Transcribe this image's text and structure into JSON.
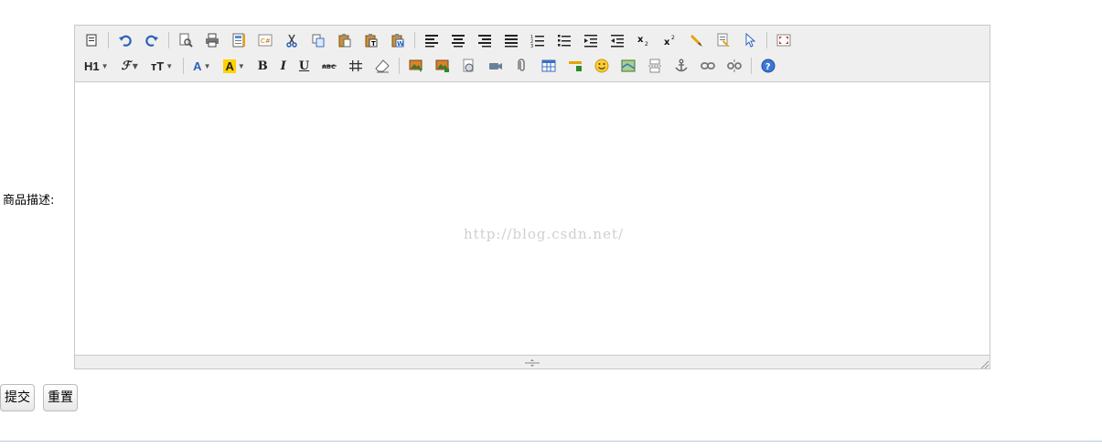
{
  "form": {
    "description_label": "商品描述:",
    "submit_label": "提交",
    "reset_label": "重置"
  },
  "editor": {
    "toolbar_row2_text": {
      "heading": "H1",
      "font_family": "ℱ",
      "font_size": "ᴛT"
    },
    "watermark": "http://blog.csdn.net/"
  },
  "colors": {
    "toolbar_bg": "#efefef",
    "border": "#c8c8c8",
    "icon_blue": "#2d62b8",
    "highlight_yellow": "#ffd200",
    "watermark": "#cfcfcf"
  }
}
